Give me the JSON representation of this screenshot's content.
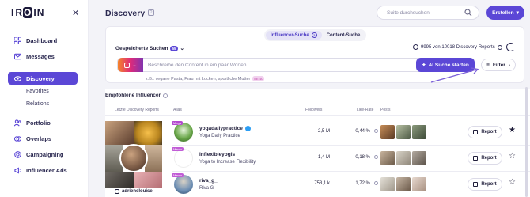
{
  "brand": {
    "logo_text": "IROIN",
    "accent": "#5b47d6"
  },
  "sidebar": {
    "items": [
      {
        "label": "Dashboard",
        "icon": "grid-icon"
      },
      {
        "label": "Messages",
        "icon": "mail-icon"
      },
      {
        "label": "Discovery",
        "icon": "eye-icon",
        "active": true
      },
      {
        "label": "Favorites",
        "sub": true
      },
      {
        "label": "Relations",
        "sub": true
      },
      {
        "label": "Portfolio",
        "icon": "users-icon"
      },
      {
        "label": "Overlaps",
        "icon": "overlap-icon"
      },
      {
        "label": "Campaigning",
        "icon": "target-icon"
      },
      {
        "label": "Influencer Ads",
        "icon": "megaphone-icon"
      }
    ]
  },
  "header": {
    "title": "Discovery",
    "search_placeholder": "Suite durchsuchen",
    "create_label": "Erstellen"
  },
  "search_card": {
    "tabs": [
      {
        "label": "Influencer-Suche",
        "active": true
      },
      {
        "label": "Content-Suche",
        "active": false
      }
    ],
    "saved_label": "Gespeicherte Suchen",
    "saved_count": "55",
    "quota_text": "9995 von 10018 Discovery Reports",
    "platform": "Instagram",
    "input_placeholder": "Beschreibe den Content in ein paar Worten",
    "ai_button": "AI Suche starten",
    "filter_button": "Filter",
    "hint_text": "z.B.: vegane Pasta, Frau mit Locken, sportliche Mutter",
    "hint_badge": "BETA"
  },
  "recommended": {
    "title": "Empfohlene Influencer",
    "columns": {
      "reports": "Letzte Discovery Reports",
      "alias": "Alias",
      "followers": "Followers",
      "like_rate": "Like-Rate",
      "posts": "Posts"
    },
    "collage_user": "adrienelouise",
    "report_label": "Report",
    "rows": [
      {
        "tag": "Mega",
        "tag_color": "#b44ad0",
        "username": "yogadailypractice",
        "subtitle": "Yoga Daily Practice",
        "followers": "2,5 M",
        "like_rate": "0,44 %",
        "verified": true,
        "starred": true,
        "avatar_bg": "#5a8a3a"
      },
      {
        "tag": "Macro",
        "tag_color": "#c15dd6",
        "username": "inflexibleyogis",
        "subtitle": "Yoga to Increase Flexibility",
        "followers": "1,4 M",
        "like_rate": "0,18 %",
        "verified": false,
        "starred": false,
        "avatar_bg": "#ffffff"
      },
      {
        "tag": "Macro",
        "tag_color": "#c15dd6",
        "username": "riva_g_",
        "subtitle": "Riva G",
        "followers": "753,1 k",
        "like_rate": "1,72 %",
        "verified": false,
        "starred": false,
        "avatar_bg": "#6b8db3"
      }
    ]
  }
}
